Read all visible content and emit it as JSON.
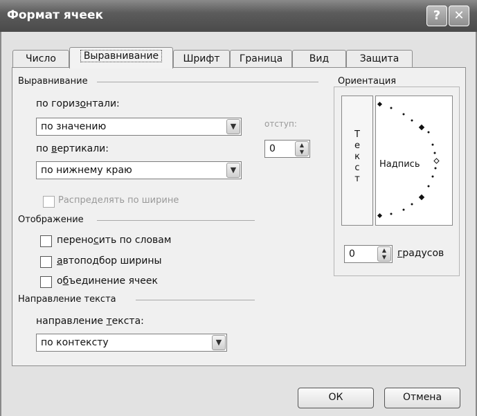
{
  "window": {
    "title": "Формат ячеек",
    "help_glyph": "?",
    "close_glyph": "✕"
  },
  "tabs": [
    {
      "label": "Число"
    },
    {
      "label": "Выравнивание",
      "active": true
    },
    {
      "label": "Шрифт"
    },
    {
      "label": "Граница"
    },
    {
      "label": "Вид"
    },
    {
      "label": "Защита"
    }
  ],
  "alignment": {
    "section": "Выравнивание",
    "horizontal_label_a": "по гориз",
    "horizontal_label_u": "о",
    "horizontal_label_b": "нтали:",
    "horizontal_value": "по значению",
    "indent_label": "отступ:",
    "indent_value": "0",
    "vertical_label_a": "по ",
    "vertical_label_u": "в",
    "vertical_label_b": "ертикали:",
    "vertical_value": "по нижнему краю",
    "distribute_label": "Распределять по ширине"
  },
  "display": {
    "section": "Отображение",
    "wrap_a": "перено",
    "wrap_u": "с",
    "wrap_b": "ить по словам",
    "shrink_u": "а",
    "shrink_b": "втоподбор ширины",
    "merge_a": "о",
    "merge_u": "б",
    "merge_b": "ъединение ячеек"
  },
  "direction": {
    "section": "Направление текста",
    "label_a": "направление ",
    "label_u": "т",
    "label_b": "екста:",
    "value": "по контексту"
  },
  "orientation": {
    "section": "Ориентация",
    "vertical_text": [
      "Т",
      "е",
      "к",
      "с",
      "т"
    ],
    "inscription": "Надпись",
    "degrees_value": "0",
    "degrees_u": "г",
    "degrees_b": "радусов"
  },
  "buttons": {
    "ok": "ОК",
    "cancel": "Отмена"
  }
}
